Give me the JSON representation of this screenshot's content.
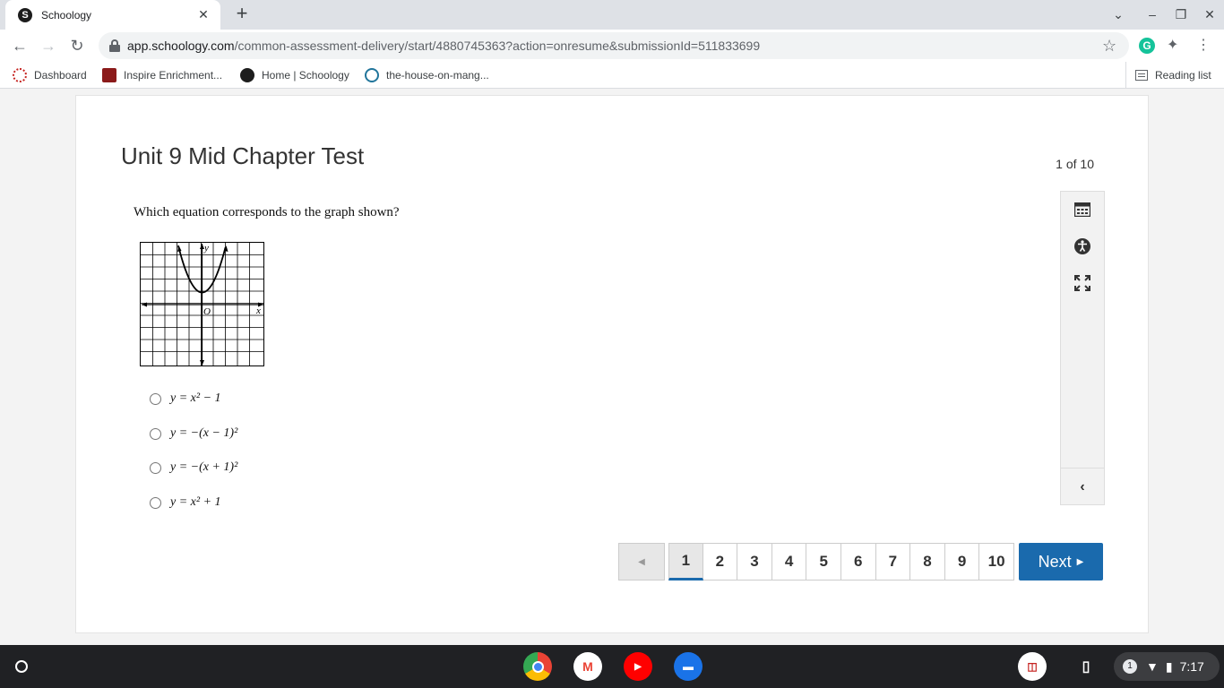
{
  "browser": {
    "tab_title": "Schoology",
    "tab_favicon_letter": "S",
    "url_host": "app.schoology.com",
    "url_path": "/common-assessment-delivery/start/4880745363?action=onresume&submissionId=511833699",
    "extension_letter": "G"
  },
  "bookmarks": {
    "items": [
      {
        "label": "Dashboard"
      },
      {
        "label": "Inspire Enrichment..."
      },
      {
        "label": "Home | Schoology"
      },
      {
        "label": "the-house-on-mang..."
      }
    ],
    "reading_list": "Reading list"
  },
  "assessment": {
    "title": "Unit 9 Mid Chapter Test",
    "counter": "1 of 10",
    "question": "Which equation corresponds to the graph shown?",
    "graph_labels": {
      "y": "y",
      "x": "x",
      "origin": "O"
    },
    "choices": [
      {
        "text": "y = x² − 1"
      },
      {
        "text": "y = −(x − 1)²"
      },
      {
        "text": "y = −(x + 1)²"
      },
      {
        "text": "y = x² + 1"
      }
    ]
  },
  "tools": {
    "items": [
      "calculator-icon",
      "accessibility-icon",
      "fullscreen-icon"
    ],
    "collapse": "‹"
  },
  "pager": {
    "prev": "◀",
    "pages": [
      "1",
      "2",
      "3",
      "4",
      "5",
      "6",
      "7",
      "8",
      "9",
      "10"
    ],
    "active": "1",
    "next_label": "Next",
    "next_arrow": "▶"
  },
  "shelf": {
    "notification_count": "1",
    "time": "7:17"
  },
  "colors": {
    "accent": "#1a6aad",
    "shelf": "#202124"
  }
}
